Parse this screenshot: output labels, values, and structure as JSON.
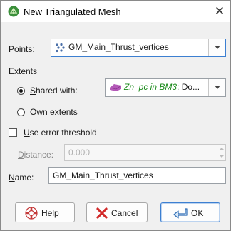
{
  "window": {
    "title": "New Triangulated Mesh",
    "close_glyph": "✕"
  },
  "points": {
    "label_key": "P",
    "label_rest": "oints:",
    "value": "GM_Main_Thrust_vertices",
    "icon": "points-icon"
  },
  "extents": {
    "heading": "Extents",
    "shared_with": {
      "label_key": "S",
      "label_rest": "hared with:",
      "checked": true,
      "value_italic": "Zn_pc in BM3",
      "value_rest": ": Do...",
      "icon": "block-model-icon"
    },
    "own_extents": {
      "label_pre": "Own e",
      "label_key": "x",
      "label_post": "tents",
      "checked": false
    }
  },
  "error_threshold": {
    "label_key": "U",
    "label_rest": "se error threshold",
    "checked": false
  },
  "distance": {
    "label_key": "D",
    "label_rest": "istance:",
    "value": "0.000",
    "disabled": true
  },
  "name": {
    "label_key": "N",
    "label_rest": "ame:",
    "value": "GM_Main_Thrust_vertices"
  },
  "buttons": {
    "help": {
      "key": "H",
      "rest": "elp",
      "icon": "help-icon"
    },
    "cancel": {
      "key": "C",
      "rest": "ancel",
      "icon": "cancel-icon"
    },
    "ok": {
      "key": "O",
      "rest": "K",
      "icon": "ok-icon"
    }
  },
  "colors": {
    "accent": "#3c7fd1",
    "zn_text": "#1a8a1a",
    "app_icon": "#3a8f3a"
  }
}
